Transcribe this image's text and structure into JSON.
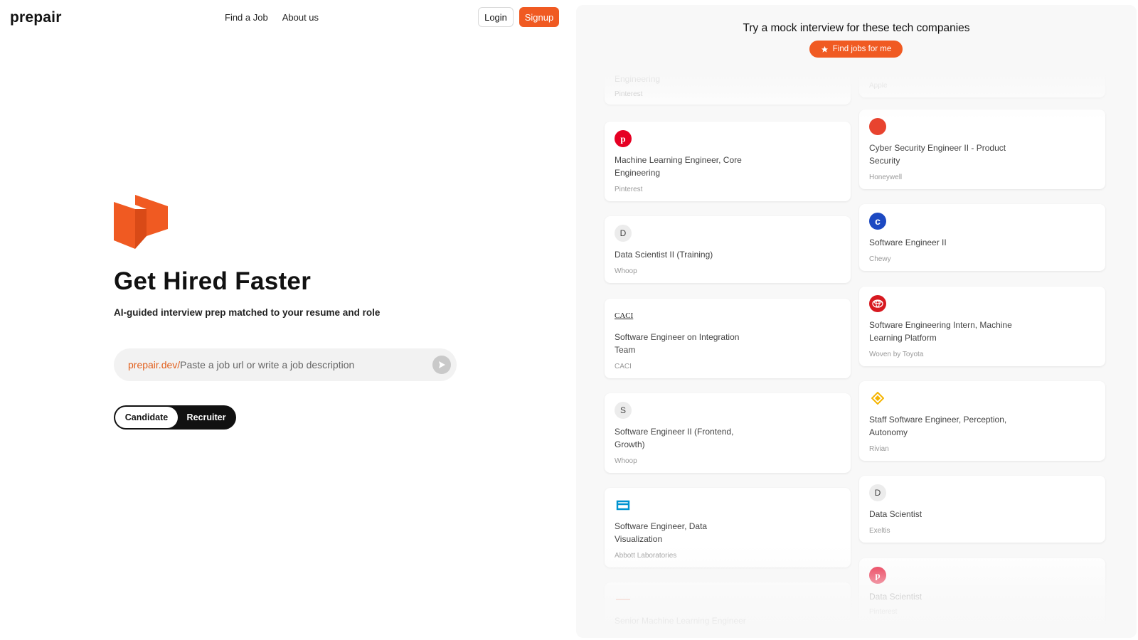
{
  "header": {
    "logo": "prepair",
    "nav": [
      "Find a Job",
      "About us"
    ],
    "login_label": "Login",
    "signup_label": "Signup"
  },
  "hero": {
    "title": "Get Hired Faster",
    "subtitle": "AI-guided interview prep matched to your resume and role",
    "search_prefix": "prepair.dev/",
    "search_placeholder": "Paste a job url or write a job description",
    "toggle": [
      "Candidate",
      "Recruiter"
    ],
    "toggle_active": "Candidate"
  },
  "panel": {
    "title": "Try a mock interview for these tech companies",
    "find_button": "Find jobs for me"
  },
  "jobs_left": [
    {
      "role": "Engineering",
      "company": "Pinterest",
      "icon": "pinterest-icon"
    },
    {
      "role": "Machine Learning Engineer, Core Engineering",
      "company": "Pinterest",
      "icon": "pinterest-icon"
    },
    {
      "role": "Data Scientist II (Training)",
      "company": "Whoop",
      "icon": "letter-d-icon",
      "letter": "D"
    },
    {
      "role": "Software Engineer on Integration Team",
      "company": "CACI",
      "icon": "caci-logo",
      "letter": "CACI"
    },
    {
      "role": "Software Engineer II (Frontend, Growth)",
      "company": "Whoop",
      "icon": "letter-s-icon",
      "letter": "S"
    },
    {
      "role": "Software Engineer, Data Visualization",
      "company": "Abbott Laboratories",
      "icon": "abbott-icon"
    },
    {
      "role": "Senior Machine Learning Engineer",
      "company": "",
      "icon": "faded-logo-icon"
    }
  ],
  "jobs_right": [
    {
      "role": "",
      "company": "Apple",
      "icon": "apple-icon"
    },
    {
      "role": "Cyber Security Engineer II - Product Security",
      "company": "Honeywell",
      "icon": "honeywell-icon"
    },
    {
      "role": "Software Engineer II",
      "company": "Chewy",
      "icon": "chewy-icon"
    },
    {
      "role": "Software Engineering Intern, Machine Learning Platform",
      "company": "Woven by Toyota",
      "icon": "toyota-icon"
    },
    {
      "role": "Staff Software Engineer, Perception, Autonomy",
      "company": "Rivian",
      "icon": "rivian-icon"
    },
    {
      "role": "Data Scientist",
      "company": "Exeltis",
      "icon": "letter-d-icon",
      "letter": "D"
    },
    {
      "role": "Data Scientist",
      "company": "Pinterest",
      "icon": "pinterest-icon"
    }
  ],
  "colors": {
    "accent": "#f05a22",
    "dark": "#111111",
    "panel_bg": "#f8f8f8"
  }
}
